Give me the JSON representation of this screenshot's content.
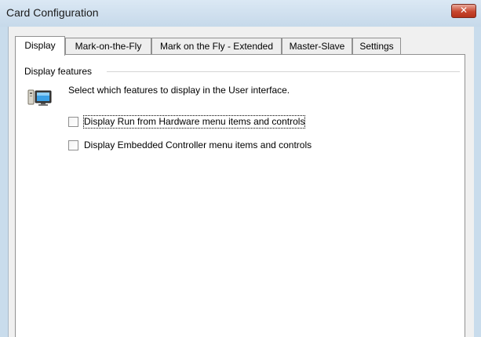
{
  "window": {
    "title": "Card Configuration",
    "close_glyph": "✕"
  },
  "tabs": [
    {
      "label": "Display",
      "active": true
    },
    {
      "label": "Mark-on-the-Fly",
      "active": false
    },
    {
      "label": "Mark on the Fly - Extended",
      "active": false
    },
    {
      "label": "Master-Slave",
      "active": false
    },
    {
      "label": "Settings",
      "active": false
    }
  ],
  "display_panel": {
    "group_label": "Display features",
    "icon": "monitor-computer-icon",
    "description": "Select which features to display in the User interface.",
    "options": [
      {
        "label": "Display Run from Hardware menu items and controls",
        "checked": false,
        "focused": true
      },
      {
        "label": "Display Embedded Controller menu items and controls",
        "checked": false,
        "focused": false
      }
    ]
  },
  "colors": {
    "window_frame": "#c9dcec",
    "close_button": "#c7462e",
    "panel_background": "#ffffff"
  }
}
